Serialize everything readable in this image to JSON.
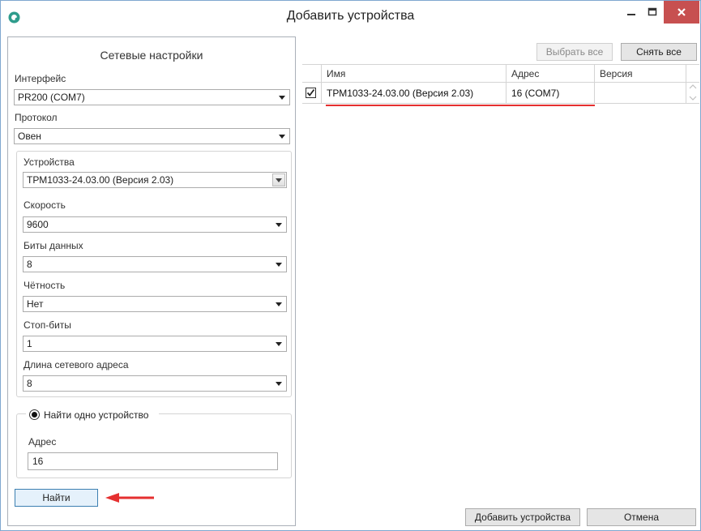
{
  "window": {
    "title": "Добавить устройства",
    "icon": "app-logo-icon",
    "controls": [
      "minimize-icon",
      "maximize-icon",
      "close-icon"
    ],
    "close_color": "#c75050"
  },
  "left": {
    "heading": "Сетевые настройки",
    "interface_label": "Интерфейс",
    "interface_value": "PR200 (COM7)",
    "protocol_label": "Протокол",
    "protocol_value": "Овен",
    "devices_label": "Устройства",
    "devices_value": "ТРМ1033-24.03.00 (Версия 2.03)",
    "speed_label": "Скорость",
    "speed_value": "9600",
    "databits_label": "Биты данных",
    "databits_value": "8",
    "parity_label": "Чётность",
    "parity_value": "Нет",
    "stopbits_label": "Стоп-биты",
    "stopbits_value": "1",
    "addrlen_label": "Длина сетевого адреса",
    "addrlen_value": "8",
    "find_one_label": "Найти одно устройство",
    "address_label": "Адрес",
    "address_value": "16",
    "find_button": "Найти"
  },
  "right": {
    "select_all": "Выбрать все",
    "deselect_all": "Снять все",
    "columns": [
      "Имя",
      "Адрес",
      "Версия"
    ],
    "rows": [
      {
        "checked": true,
        "name": "ТРМ1033-24.03.00 (Версия 2.03)",
        "address": "16 (COM7)",
        "version": ""
      }
    ],
    "add_button": "Добавить устройства",
    "cancel_button": "Отмена"
  },
  "colors": {
    "accent_red": "#e53030",
    "border": "#acacac"
  }
}
